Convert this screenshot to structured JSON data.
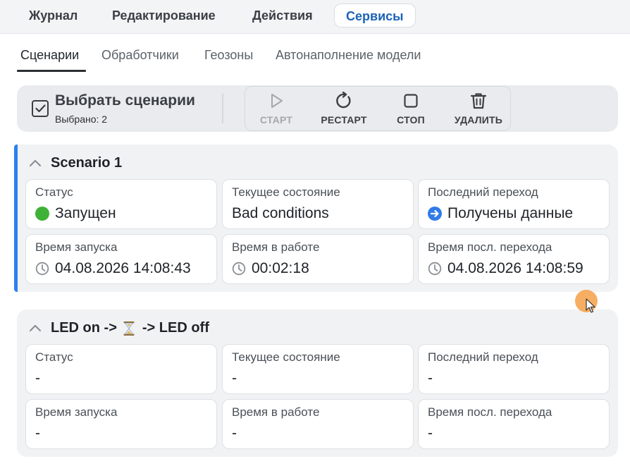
{
  "menu": {
    "tabs": [
      {
        "label": "Журнал"
      },
      {
        "label": "Редактирование"
      },
      {
        "label": "Действия"
      },
      {
        "label": "Сервисы"
      }
    ],
    "active_index": 3
  },
  "subtabs": {
    "tabs": [
      {
        "label": "Сценарии"
      },
      {
        "label": "Обработчики"
      },
      {
        "label": "Геозоны"
      },
      {
        "label": "Автонаполнение модели"
      }
    ],
    "active_index": 0
  },
  "toolbar": {
    "select_title": "Выбрать сценарии",
    "selected_text": "Выбрано: 2",
    "actions": [
      {
        "label": "СТАРТ",
        "icon": "play-icon",
        "enabled": false
      },
      {
        "label": "РЕСТАРТ",
        "icon": "restart-icon",
        "enabled": true
      },
      {
        "label": "СТОП",
        "icon": "stop-icon",
        "enabled": true
      },
      {
        "label": "УДАЛИТЬ",
        "icon": "trash-icon",
        "enabled": true
      }
    ]
  },
  "scenarios": [
    {
      "title": "Scenario 1",
      "selected": true,
      "status_label": "Статус",
      "status_value": "Запущен",
      "status_color": "#3db236",
      "state_label": "Текущее состояние",
      "state_value": "Bad conditions",
      "transition_label": "Последний переход",
      "transition_value": "Получены данные",
      "start_label": "Время запуска",
      "start_value": "04.08.2026 14:08:43",
      "uptime_label": "Время в работе",
      "uptime_value": "00:02:18",
      "last_label": "Время посл. перехода",
      "last_value": "04.08.2026 14:08:59"
    },
    {
      "title_part1": "LED on ->",
      "title_icon": "hourglass-icon",
      "title_part2": "-> LED off",
      "selected": false,
      "status_label": "Статус",
      "status_value": "-",
      "state_label": "Текущее состояние",
      "state_value": "-",
      "transition_label": "Последний переход",
      "transition_value": "-",
      "start_label": "Время запуска",
      "start_value": "-",
      "uptime_label": "Время в работе",
      "uptime_value": "-",
      "last_label": "Время посл. перехода",
      "last_value": "-"
    }
  ],
  "colors": {
    "accent": "#2d7ff0",
    "active_tab_text": "#1b63b8",
    "running": "#3db236"
  }
}
